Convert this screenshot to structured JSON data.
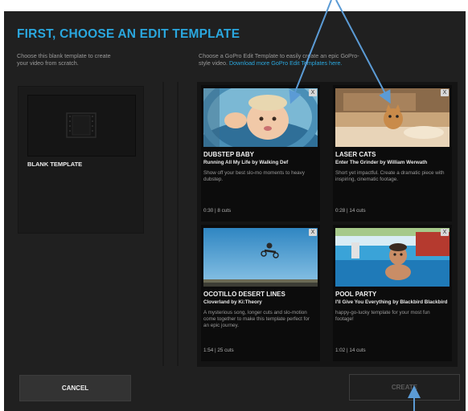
{
  "title": "FIRST, CHOOSE AN EDIT TEMPLATE",
  "left_intro": {
    "line1": "Choose this blank template to create",
    "line2": "your video from scratch."
  },
  "right_intro": {
    "line1": "Choose a GoPro Edit Template to easily create an epic GoPro-",
    "line2_prefix": "style video.",
    "link": "Download more GoPro Edit Templates here."
  },
  "blank_template": {
    "label": "BLANK TEMPLATE"
  },
  "templates": [
    {
      "title": "DUBSTEP BABY",
      "song": "Running All My Life by Walking Def",
      "description": "Show off your best slo-mo moments to heavy dubstep.",
      "duration": "0:30",
      "cuts": "8 cuts",
      "close": "X"
    },
    {
      "title": "LASER CATS",
      "song": "Enter The Grinder by William Werwath",
      "description": "Short yet impactful. Create a dramatic piece with inspiring, cinematic footage.",
      "duration": "0:28",
      "cuts": "14 cuts",
      "close": "X"
    },
    {
      "title": "OCOTILLO DESERT LINES",
      "song": "Cloverland by Ki:Theory",
      "description": "A mysterious song, longer cuts and slo-motion come together to make this template perfect for an epic journey.",
      "duration": "1:54",
      "cuts": "25 cuts",
      "close": "X"
    },
    {
      "title": "POOL PARTY",
      "song": "I'll Give You Everything by Blackbird Blackbird",
      "description": "happy-go-lucky template for your most fun footage!",
      "duration": "1:02",
      "cuts": "14 cuts",
      "close": "X"
    }
  ],
  "buttons": {
    "cancel": "CANCEL",
    "create": "CREATE"
  },
  "colors": {
    "accent": "#2aa7de",
    "window_bg": "#202020",
    "card_bg": "#0c0c0c",
    "annotation_arrow": "#5b9bd5"
  }
}
